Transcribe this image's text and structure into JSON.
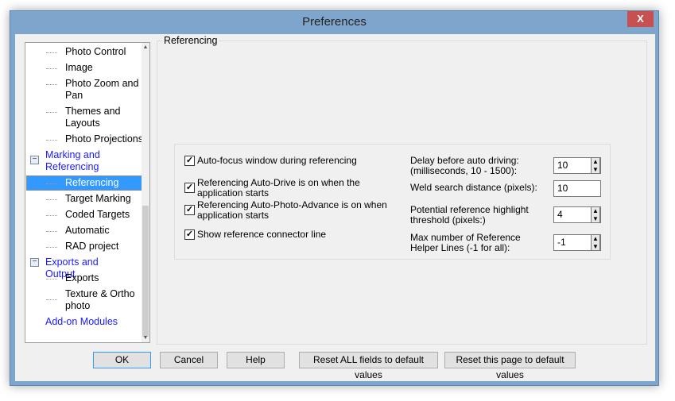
{
  "window": {
    "title": "Preferences",
    "close_label": "X"
  },
  "tree": {
    "items": [
      {
        "label": "Photo Control",
        "type": "child"
      },
      {
        "label": "Image",
        "type": "child"
      },
      {
        "label": "Photo Zoom and Pan",
        "type": "child"
      },
      {
        "label": "Themes and Layouts",
        "type": "child"
      },
      {
        "label": "Photo Projections",
        "type": "child"
      },
      {
        "label": "Marking and Referencing",
        "type": "parent",
        "expanded": true
      },
      {
        "label": "Referencing",
        "type": "child",
        "selected": true
      },
      {
        "label": "Target Marking",
        "type": "child"
      },
      {
        "label": "Coded Targets",
        "type": "child"
      },
      {
        "label": "Automatic",
        "type": "child"
      },
      {
        "label": "RAD project",
        "type": "child"
      },
      {
        "label": "Exports and Output",
        "type": "parent",
        "expanded": true
      },
      {
        "label": "Exports",
        "type": "child"
      },
      {
        "label": "Texture & Ortho photo",
        "type": "child"
      },
      {
        "label": "Add-on Modules",
        "type": "parent"
      }
    ]
  },
  "panel": {
    "title": "Referencing",
    "checkboxes": [
      {
        "label": "Auto-focus window during referencing",
        "checked": true
      },
      {
        "label": "Referencing Auto-Drive is on when the application starts",
        "checked": true
      },
      {
        "label": "Referencing Auto-Photo-Advance is on when application starts",
        "checked": true
      },
      {
        "label": "Show reference connector line",
        "checked": true
      }
    ],
    "fields": [
      {
        "label": "Delay before auto driving: (milliseconds, 10 - 1500):",
        "value": "10",
        "spinner": true
      },
      {
        "label": "Weld search distance (pixels):",
        "value": "10",
        "spinner": false
      },
      {
        "label": "Potential reference highlight threshold (pixels:)",
        "value": "4",
        "spinner": true
      },
      {
        "label": "Max number of Reference Helper Lines (-1 for all):",
        "value": "-1",
        "spinner": true
      }
    ]
  },
  "buttons": {
    "ok": "OK",
    "cancel": "Cancel",
    "help": "Help",
    "reset_all": "Reset ALL fields to default values",
    "reset_page": "Reset this page to default values"
  },
  "colors": {
    "titlebar": "#7ea6cc",
    "selection": "#3399ff",
    "parent_link": "#1a1aff",
    "close": "#c75050"
  }
}
